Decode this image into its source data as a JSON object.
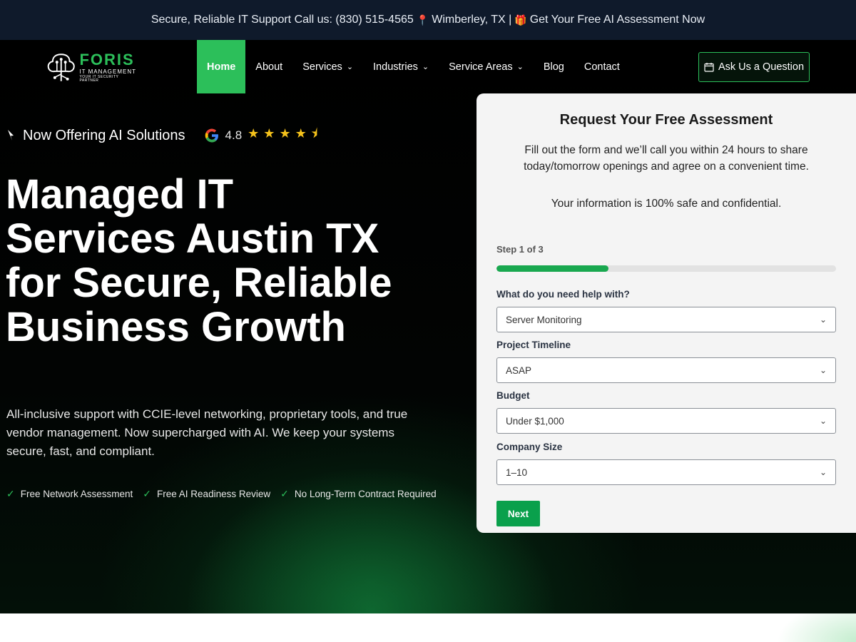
{
  "topbar": {
    "support_text": "Secure, Reliable IT Support Call us: (830) 515-4565",
    "location_icon": "map-pin-icon",
    "location": "Wimberley, TX |",
    "gift_icon": "gift-icon",
    "cta": "Get Your Free AI Assessment Now"
  },
  "logo": {
    "name": "FORIS",
    "sub": "IT MANAGEMENT",
    "tag": "YOUR IT SECURITY PARTNER",
    "icon": "circuit-tree-logo-icon"
  },
  "nav": {
    "items": [
      {
        "label": "Home",
        "dropdown": false,
        "active": true
      },
      {
        "label": "About",
        "dropdown": false,
        "active": false
      },
      {
        "label": "Services",
        "dropdown": true,
        "active": false
      },
      {
        "label": "Industries",
        "dropdown": true,
        "active": false
      },
      {
        "label": "Service Areas",
        "dropdown": true,
        "active": false
      },
      {
        "label": "Blog",
        "dropdown": false,
        "active": false
      },
      {
        "label": "Contact",
        "dropdown": false,
        "active": false
      }
    ],
    "ask_button": "Ask Us a Question",
    "ask_icon": "calendar-icon"
  },
  "hero": {
    "offer_icon": "sparkle-icon",
    "offer_text": "Now Offering AI Solutions",
    "rating_icon": "google-icon",
    "rating_value": "4.8",
    "stars": 4.5,
    "headline": "Managed IT Services Austin TX for Secure, Reliable Business Growth",
    "subtext": "All-inclusive support with CCIE-level networking, proprietary tools, and true vendor management. Now supercharged with AI. We keep your systems secure, fast, and compliant.",
    "checks": [
      "Free Network Assessment",
      "Free AI Readiness Review",
      "No Long-Term Contract Required"
    ]
  },
  "form": {
    "title": "Request Your Free Assessment",
    "description": "Fill out the form and we’ll call you within 24 hours to share today/tomorrow openings and agree on a convenient time.",
    "safe_note": "Your information is 100% safe and confidential.",
    "step_text": "Step 1 of 3",
    "progress": 0.33,
    "fields": {
      "help": {
        "label": "What do you need help with?",
        "value": "Server Monitoring"
      },
      "timeline": {
        "label": "Project Timeline",
        "value": "ASAP"
      },
      "budget": {
        "label": "Budget",
        "value": "Under $1,000"
      },
      "size": {
        "label": "Company Size",
        "value": "1–10"
      }
    },
    "next_label": "Next"
  },
  "colors": {
    "accent": "#2cbf5a",
    "topbar_bg": "#0f1a2b",
    "hero_bg": "#000000",
    "card_bg": "#f4f4f4",
    "star": "#f5c21b"
  }
}
